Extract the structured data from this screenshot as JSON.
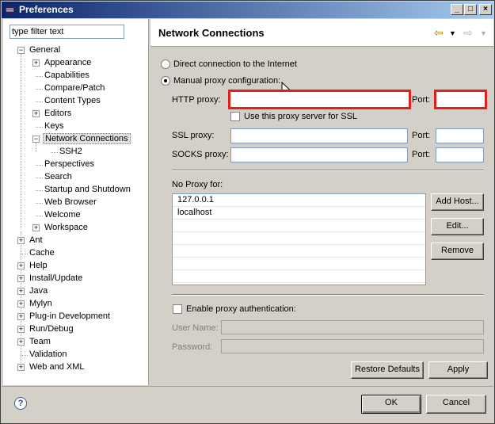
{
  "window": {
    "title": "Preferences"
  },
  "filter": {
    "placeholder": "type filter text",
    "value": "type filter text"
  },
  "tree": [
    {
      "label": "General",
      "expander": "−"
    },
    {
      "label": "Appearance",
      "expander": "+"
    },
    {
      "label": "Capabilities",
      "expander": ""
    },
    {
      "label": "Compare/Patch",
      "expander": ""
    },
    {
      "label": "Content Types",
      "expander": ""
    },
    {
      "label": "Editors",
      "expander": "+"
    },
    {
      "label": "Keys",
      "expander": ""
    },
    {
      "label": "Network Connections",
      "expander": "−"
    },
    {
      "label": "SSH2",
      "expander": ""
    },
    {
      "label": "Perspectives",
      "expander": ""
    },
    {
      "label": "Search",
      "expander": ""
    },
    {
      "label": "Startup and Shutdown",
      "expander": ""
    },
    {
      "label": "Web Browser",
      "expander": ""
    },
    {
      "label": "Welcome",
      "expander": ""
    },
    {
      "label": "Workspace",
      "expander": "+"
    },
    {
      "label": "Ant",
      "expander": "+"
    },
    {
      "label": "Cache",
      "expander": ""
    },
    {
      "label": "Help",
      "expander": "+"
    },
    {
      "label": "Install/Update",
      "expander": "+"
    },
    {
      "label": "Java",
      "expander": "+"
    },
    {
      "label": "Mylyn",
      "expander": "+"
    },
    {
      "label": "Plug-in Development",
      "expander": "+"
    },
    {
      "label": "Run/Debug",
      "expander": "+"
    },
    {
      "label": "Team",
      "expander": "+"
    },
    {
      "label": "Validation",
      "expander": ""
    },
    {
      "label": "Web and XML",
      "expander": "+"
    }
  ],
  "page": {
    "title": "Network Connections",
    "direct_label": "Direct connection to the Internet",
    "manual_label": "Manual proxy configuration:",
    "http_label": "HTTP proxy:",
    "port_label": "Port:",
    "ssl_same_label": "Use this proxy server for SSL",
    "ssl_label": "SSL proxy:",
    "socks_label": "SOCKS proxy:",
    "no_proxy_label": "No Proxy for:",
    "no_proxy_items": [
      "127.0.0.1",
      "localhost"
    ],
    "add_host": "Add Host...",
    "edit": "Edit...",
    "remove": "Remove",
    "auth_label": "Enable proxy authentication:",
    "user_label": "User Name:",
    "password_label": "Password:",
    "restore_defaults": "Restore Defaults",
    "apply": "Apply"
  },
  "footer": {
    "ok": "OK",
    "cancel": "Cancel"
  },
  "icons": {
    "back": "back-arrow-icon",
    "forward": "forward-arrow-icon",
    "help": "help-icon",
    "direct_selected": false,
    "manual_selected": true
  },
  "colors": {
    "highlight": "#e0201b",
    "title_gradient_start": "#0a246a",
    "title_gradient_end": "#a6caf0"
  }
}
